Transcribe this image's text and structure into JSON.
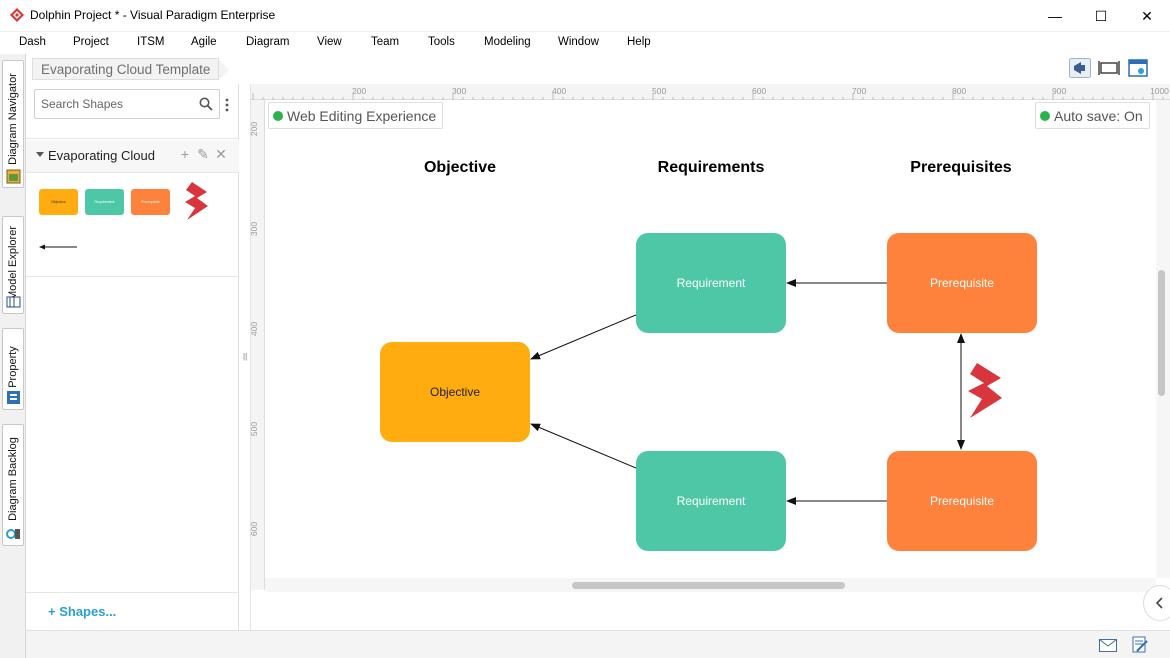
{
  "window": {
    "title": "Dolphin Project * - Visual Paradigm Enterprise",
    "controls": {
      "minimize": "—",
      "maximize": "☐",
      "close": "✕"
    }
  },
  "menu": [
    "Dash",
    "Project",
    "ITSM",
    "Agile",
    "Diagram",
    "View",
    "Team",
    "Tools",
    "Modeling",
    "Window",
    "Help"
  ],
  "side_tabs": [
    "Diagram Navigator",
    "Model Explorer",
    "Property",
    "Diagram Backlog"
  ],
  "breadcrumb": "Evaporating Cloud Template",
  "shapes_panel": {
    "search_placeholder": "Search Shapes",
    "group_title": "Evaporating Cloud",
    "mini_shapes": [
      {
        "label": "Objective",
        "color": "#ffac10"
      },
      {
        "label": "Requirement",
        "color": "#4dc7a6"
      },
      {
        "label": "Prerequisite",
        "color": "#ff823c"
      }
    ],
    "shapes_link": "Shapes..."
  },
  "rulers": {
    "top": [
      "200",
      "300",
      "400",
      "500",
      "600",
      "700",
      "800",
      "900",
      "1000"
    ],
    "left": [
      "200",
      "300",
      "400",
      "500",
      "600"
    ]
  },
  "canvas": {
    "web_editing": "Web Editing Experience",
    "auto_save": "Auto save: On",
    "columns": [
      "Objective",
      "Requirements",
      "Prerequisites"
    ],
    "nodes": {
      "objective": "Objective",
      "requirement_top": "Requirement",
      "requirement_bottom": "Requirement",
      "prerequisite_top": "Prerequisite",
      "prerequisite_bottom": "Prerequisite"
    }
  },
  "colors": {
    "objective": "#ffac10",
    "requirement": "#4dc7a6",
    "prerequisite": "#ff823c",
    "conflict": "#d9353c",
    "status_on": "#2bb24c",
    "link": "#2a9fd6"
  }
}
